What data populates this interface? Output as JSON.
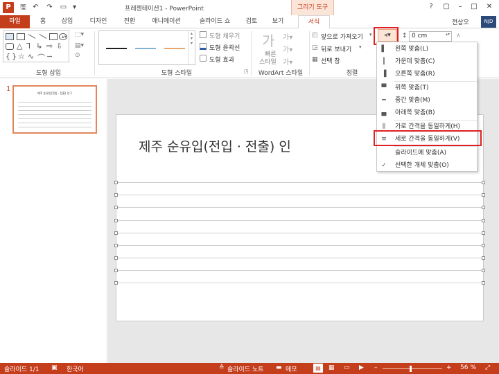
{
  "app": {
    "title": "프레젠테이션1 - PowerPoint",
    "tool_group": "그리기 도구",
    "icon": "P"
  },
  "quick_access": {
    "save_icon": "save-icon",
    "undo_icon": "undo-icon",
    "redo_icon": "redo-icon",
    "start_icon": "slideshow-icon"
  },
  "window_controls": {
    "help": "?",
    "restore_ribbon": "▢",
    "minimize": "–",
    "maximize": "□",
    "close": "✕"
  },
  "tabs": [
    {
      "label": "파일"
    },
    {
      "label": "홈"
    },
    {
      "label": "삽입"
    },
    {
      "label": "디자인"
    },
    {
      "label": "전환"
    },
    {
      "label": "애니메이션"
    },
    {
      "label": "슬라이드 쇼"
    },
    {
      "label": "검토"
    },
    {
      "label": "보기"
    },
    {
      "label": "서식"
    }
  ],
  "user": {
    "name": "전상오",
    "avatar_text": "NJD"
  },
  "ribbon": {
    "groups": {
      "insert_shapes": "도형 삽입",
      "shape_styles": "도형 스타일",
      "wordart_styles": "WordArt 스타일",
      "arrange": "정렬"
    },
    "shape_fill": "도형 채우기",
    "shape_outline": "도형 윤곽선",
    "shape_effects": "도형 효과",
    "quick_styles_line1": "빠른",
    "quick_styles_line2": "스타일",
    "bring_forward": "앞으로 가져오기",
    "send_backward": "뒤로 보내기",
    "selection_pane": "선택 창",
    "height_value": "0 cm",
    "style_line_colors": [
      "#1f1f1f",
      "#7fb2d6",
      "#e8a86a"
    ]
  },
  "align_menu": {
    "items": [
      {
        "icon": "▌",
        "label": "왼쪽 맞춤(L)"
      },
      {
        "icon": "┃",
        "label": "가운데 맞춤(C)"
      },
      {
        "icon": "▐",
        "label": "오른쪽 맞춤(R)"
      },
      {
        "icon": "▀",
        "label": "위쪽 맞춤(T)"
      },
      {
        "icon": "━",
        "label": "중간 맞춤(M)"
      },
      {
        "icon": "▄",
        "label": "아래쪽 맞춤(B)"
      },
      {
        "icon": "⫼",
        "label": "가로 간격을 동일하게(H)"
      },
      {
        "icon": "≡",
        "label": "세로 간격을 동일하게(V)"
      },
      {
        "icon": "",
        "label": "슬라이드에 맞춤(A)"
      },
      {
        "icon": "✓",
        "label": "선택한 개체 맞춤(O)"
      }
    ]
  },
  "slides_pane": {
    "slide_number": "1",
    "thumb_title": "제주 순유입(전입 - 전출) 인구"
  },
  "slide": {
    "title": "제주 순유입(전입 · 전출) 인"
  },
  "status": {
    "slide_info": "슬라이드 1/1",
    "language": "한국어",
    "notes": "슬라이드 노트",
    "comments": "메모",
    "zoom": "56 %"
  },
  "colors": {
    "accent": "#c43e1c",
    "highlight": "#e02020"
  }
}
